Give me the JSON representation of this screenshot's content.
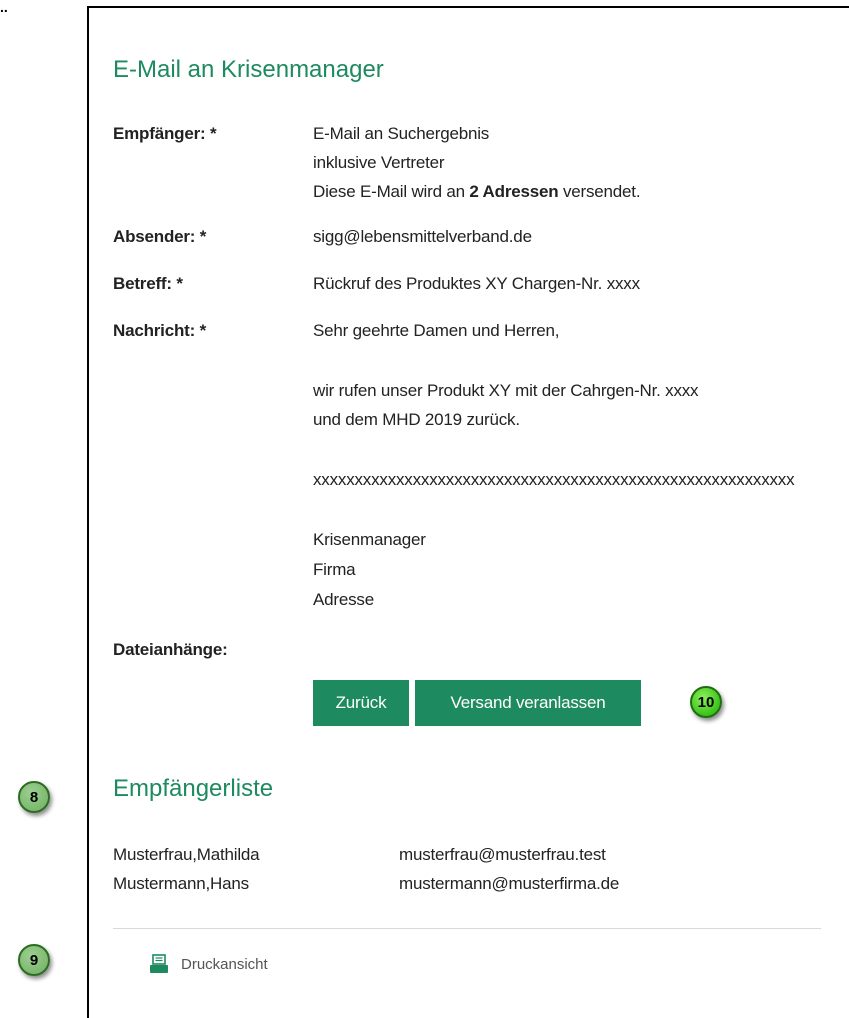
{
  "corner_mark": "..",
  "email_section": {
    "title": "E-Mail an Krisenmanager",
    "recipient": {
      "label": "Empfänger: *",
      "line1": "E-Mail an Suchergebnis",
      "line2": "inklusive Vertreter",
      "line3_prefix": "Diese E-Mail wird an ",
      "line3_bold": "2 Adressen",
      "line3_suffix": " versendet."
    },
    "sender": {
      "label": "Absender: *",
      "value": "sigg@lebensmittelverband.de"
    },
    "subject": {
      "label": "Betreff: *",
      "value": "Rückruf des Produktes XY Chargen-Nr. xxxx"
    },
    "message": {
      "label": "Nachricht: *",
      "lines": [
        "Sehr geehrte Damen und Herren,",
        "wir rufen unser Produkt XY mit der Cahrgen-Nr. xxxx",
        "und dem MHD 2019 zurück.",
        "xxxxxxxxxxxxxxxxxxxxxxxxxxxxxxxxxxxxxxxxxxxxxxxxxxxxxxxxxx",
        "Krisenmanager",
        "Firma",
        "Adresse"
      ]
    },
    "attachments": {
      "label": "Dateianhänge:"
    },
    "buttons": {
      "back": "Zurück",
      "send": "Versand veranlassen"
    }
  },
  "recipient_list": {
    "title": "Empfängerliste",
    "entries": [
      {
        "name": "Musterfrau,Mathilda",
        "email": "musterfrau@musterfrau.test"
      },
      {
        "name": "Mustermann,Hans",
        "email": "mustermann@musterfirma.de"
      }
    ]
  },
  "print_view": {
    "label": "Druckansicht",
    "icon": "printer-icon"
  },
  "badges": {
    "send_badge": "10",
    "list_badge": "8",
    "print_badge": "9"
  },
  "colors": {
    "accent": "#1e8a5f",
    "badge_bright": "#3cc21c",
    "badge_muted": "#7db86f"
  }
}
